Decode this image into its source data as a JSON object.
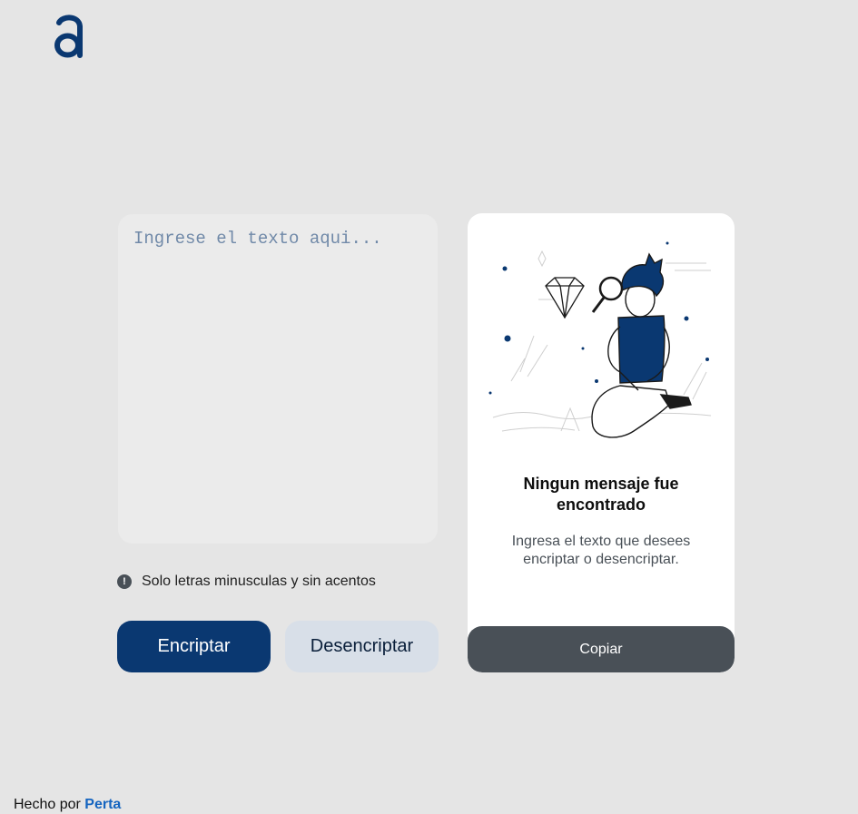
{
  "brand": {
    "logo_icon": "alura-logo-icon",
    "color": "#0a3871"
  },
  "input": {
    "placeholder": "Ingrese el texto aqui...",
    "value": ""
  },
  "hint": {
    "icon": "exclamation-circle-icon",
    "text": "Solo letras minusculas y sin acentos"
  },
  "buttons": {
    "encrypt": "Encriptar",
    "decrypt": "Desencriptar"
  },
  "output": {
    "illustration": "person-with-magnifier-illustration",
    "title": "Ningun mensaje fue encontrado",
    "text": "Ingresa el texto que desees encriptar o desencriptar.",
    "copy": "Copiar"
  },
  "footer": {
    "prefix": "Hecho por",
    "author": "Perta"
  },
  "colors": {
    "primary": "#0a3871",
    "secondary": "#d8dfe8",
    "dark": "#495057",
    "background": "#e5e5e5"
  }
}
